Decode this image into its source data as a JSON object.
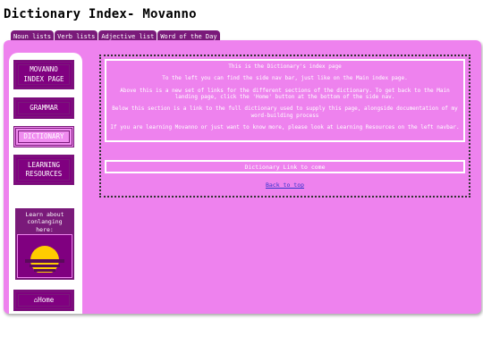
{
  "site": {
    "title": "Dictionary Index- Movanno"
  },
  "tabs": [
    {
      "label": "Noun lists"
    },
    {
      "label": "Verb lists"
    },
    {
      "label": "Adjective list"
    },
    {
      "label": "Word of the Day"
    }
  ],
  "sidebar": {
    "items": [
      {
        "label": "MOVANNO INDEX PAGE"
      },
      {
        "label": "GRAMMAR"
      },
      {
        "label": "DICTIONARY"
      },
      {
        "label": "LEARNING RESOURCES"
      }
    ],
    "learn_text": "Learn about conlanging here:",
    "home_label": "⌂Home"
  },
  "main": {
    "intro": [
      "This is the Dictionary's index page",
      "To the left you can find the side nav bar, just like on the Main index page.",
      "Above this is a new set of links for the different sections of the dictionary. To get back to the Main landing page, click the 'Home' button at the bottom of the side nav.",
      "Below this section is a link to the full dictionary used to supply this page, alongside documentation of my word-building process",
      "If you are learning Movanno or just want to know more, please look at Learning Resources on the left navbar."
    ],
    "dictionary_link": "Dictionary Link to come",
    "back_to_top": "Back to top"
  },
  "colors": {
    "accent": "#ee82ee",
    "dark_purple": "#7a1a7a",
    "link": "#3333cc"
  }
}
